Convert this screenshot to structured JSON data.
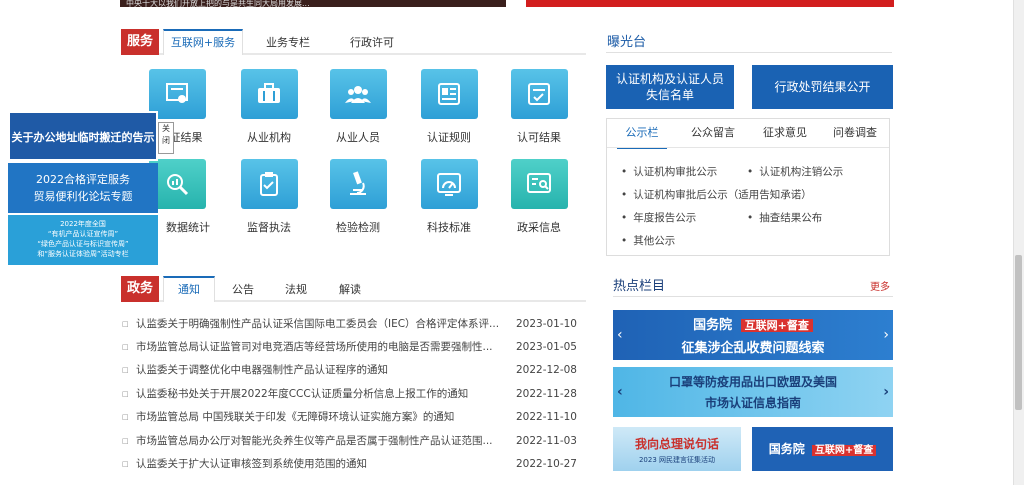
{
  "top": {
    "sliver_text": "中央十大以我们开放上把的与是共生同大局用发展..."
  },
  "service": {
    "badge": "服务",
    "tabs": [
      {
        "label": "互联网+服务",
        "active": true
      },
      {
        "label": "业务专栏",
        "active": false
      },
      {
        "label": "行政许可",
        "active": false
      }
    ],
    "items": [
      {
        "label": "证结果",
        "icon": "certificate-result-icon"
      },
      {
        "label": "从业机构",
        "icon": "briefcase-icon"
      },
      {
        "label": "从业人员",
        "icon": "people-icon"
      },
      {
        "label": "认证规则",
        "icon": "rules-document-icon"
      },
      {
        "label": "认可结果",
        "icon": "checklist-icon"
      },
      {
        "label": "数据统计",
        "icon": "statistics-icon"
      },
      {
        "label": "监督执法",
        "icon": "clipboard-icon"
      },
      {
        "label": "检验检测",
        "icon": "microscope-icon"
      },
      {
        "label": "科技标准",
        "icon": "gauge-icon"
      },
      {
        "label": "政采信息",
        "icon": "search-list-icon"
      }
    ]
  },
  "float_ads": {
    "ad1": "关于办公地址临时搬迁的告示",
    "ad2_line1": "2022合格评定服务",
    "ad2_line2": "贸易便利化论坛专题",
    "ad3_line1": "2022年度全国",
    "ad3_line2": "“有机产品认证宣传周”",
    "ad3_line3": "“绿色产品认证与标识宣传周”",
    "ad3_line4": "和“服务认证体验周”活动专栏",
    "close_line1": "关",
    "close_line2": "闭"
  },
  "policy": {
    "badge": "政务",
    "tabs": [
      {
        "label": "通知",
        "active": true
      },
      {
        "label": "公告",
        "active": false
      },
      {
        "label": "法规",
        "active": false
      },
      {
        "label": "解读",
        "active": false
      }
    ],
    "news": [
      {
        "title": "认监委关于明确强制性产品认证采信国际电工委员会（IEC）合格评定体系评...",
        "date": "2023-01-10"
      },
      {
        "title": "市场监管总局认证监管司对电竞酒店等经营场所使用的电脑是否需要强制性...",
        "date": "2023-01-05"
      },
      {
        "title": "认监委关于调整优化中电器强制性产品认证程序的通知",
        "date": "2022-12-08"
      },
      {
        "title": "认监委秘书处关于开展2022年度CCC认证质量分析信息上报工作的通知",
        "date": "2022-11-28"
      },
      {
        "title": "市场监管总局 中国残联关于印发《无障碍环境认证实施方案》的通知",
        "date": "2022-11-10"
      },
      {
        "title": "市场监管总局办公厅对智能光灸养生仪等产品是否属于强制性产品认证范围...",
        "date": "2022-11-03"
      },
      {
        "title": "认监委关于扩大认证审核签到系统使用范围的通知",
        "date": "2022-10-27"
      }
    ]
  },
  "exposure": {
    "title": "曝光台",
    "btn1_line1": "认证机构及认证人员",
    "btn1_line2": "失信名单",
    "btn2": "行政处罚结果公开",
    "tabs": [
      {
        "label": "公示栏",
        "active": true
      },
      {
        "label": "公众留言",
        "active": false
      },
      {
        "label": "征求意见",
        "active": false
      },
      {
        "label": "问卷调查",
        "active": false
      }
    ],
    "items": [
      "认证机构审批公示",
      "认证机构注销公示",
      "认证机构审批后公示（适用告知承诺）",
      "年度报告公示",
      "抽查结果公布",
      "其他公示"
    ]
  },
  "hot": {
    "title": "热点栏目",
    "more": "更多",
    "banner1_a": "国务院",
    "banner1_b": "互联网+督查",
    "banner1_c": "征集涉企乱收费问题线索",
    "banner2_line1": "口罩等防疫用品出口欧盟及美国",
    "banner2_line2": "市场认证信息指南",
    "banner3": "我向总理说句话",
    "banner3_sub": "2023 网民建言征集活动",
    "banner4_a": "国务院",
    "banner4_b": "互联网+督查"
  },
  "colors": {
    "accent_red": "#c9302c",
    "brand_blue": "#1a62b3",
    "icon_blue": "#2e9fd6",
    "icon_teal": "#27b3ad"
  }
}
